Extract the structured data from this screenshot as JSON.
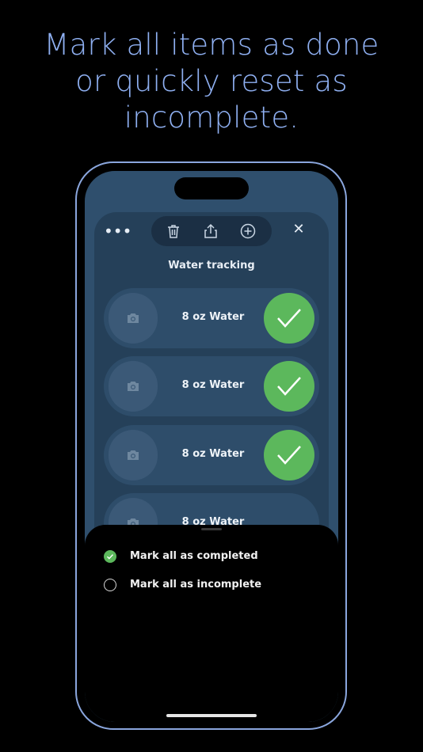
{
  "headline": {
    "line1": "Mark all items as done",
    "line2": "or quickly reset as",
    "line3": "incomplete."
  },
  "toolbar": {
    "more_icon": "ellipsis-icon",
    "more_glyph": "•••",
    "icons": [
      "trash-icon",
      "share-icon",
      "add-circle-icon"
    ],
    "close_icon": "close-icon",
    "close_glyph": "✕"
  },
  "list": {
    "title": "Water tracking",
    "items": [
      {
        "label": "8 oz Water",
        "completed": true
      },
      {
        "label": "8 oz Water",
        "completed": true
      },
      {
        "label": "8 oz Water",
        "completed": true
      },
      {
        "label": "8 oz Water",
        "completed": false
      }
    ]
  },
  "sheet": {
    "options": [
      {
        "label": "Mark all as completed",
        "selected": true
      },
      {
        "label": "Mark all as incomplete",
        "selected": false
      }
    ]
  },
  "colors": {
    "accent_green": "#5cb85c",
    "headline_blue": "#8fb0f2",
    "phone_frame": "#8aa6dd"
  }
}
